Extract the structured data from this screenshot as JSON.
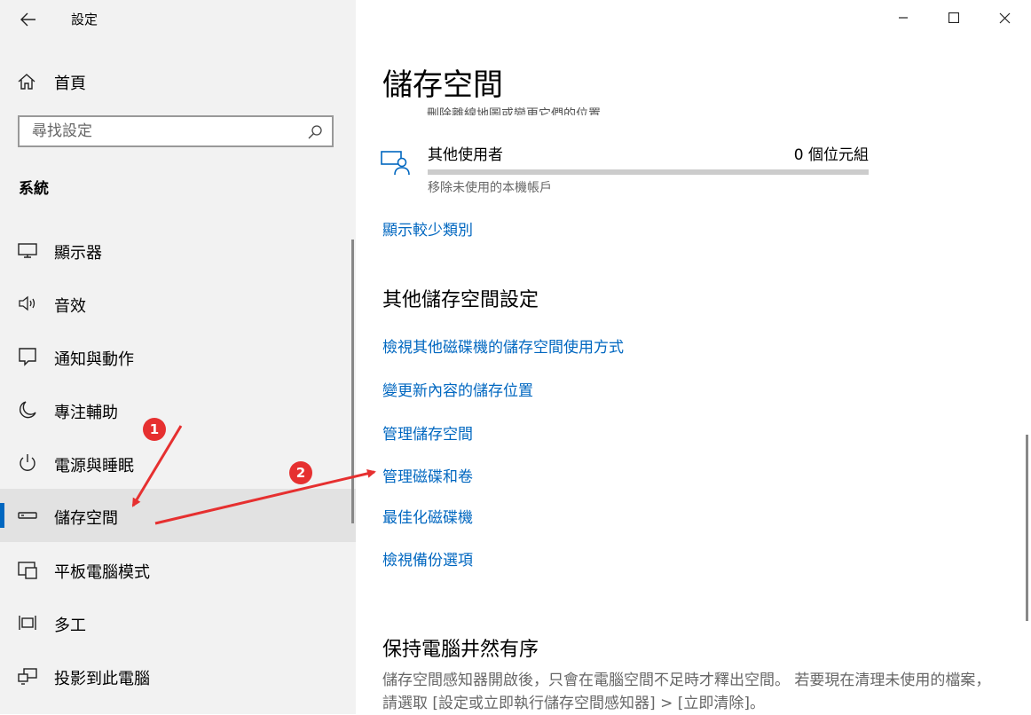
{
  "window": {
    "title": "設定",
    "back_icon": "back-arrow-icon"
  },
  "sidebar": {
    "home_label": "首頁",
    "search_placeholder": "尋找設定",
    "section_label": "系統",
    "items": [
      {
        "label": "顯示器",
        "icon": "display-icon",
        "selected": false
      },
      {
        "label": "音效",
        "icon": "speaker-icon",
        "selected": false
      },
      {
        "label": "通知與動作",
        "icon": "notification-icon",
        "selected": false
      },
      {
        "label": "專注輔助",
        "icon": "moon-icon",
        "selected": false
      },
      {
        "label": "電源與睡眠",
        "icon": "power-icon",
        "selected": false
      },
      {
        "label": "儲存空間",
        "icon": "storage-drive-icon",
        "selected": true
      },
      {
        "label": "平板電腦模式",
        "icon": "tablet-mode-icon",
        "selected": false
      },
      {
        "label": "多工",
        "icon": "multitasking-icon",
        "selected": false
      },
      {
        "label": "投影到此電腦",
        "icon": "project-icon",
        "selected": false
      }
    ]
  },
  "main": {
    "title": "儲存空間",
    "cut_off_text": "刪除離線地圖或變更它們的位置",
    "other_users": {
      "label": "其他使用者",
      "size": "0 個位元組",
      "description": "移除未使用的本機帳戶",
      "usage_fraction": 0
    },
    "show_fewer_link": "顯示較少類別",
    "more_settings_title": "其他儲存空間設定",
    "links": [
      "檢視其他磁碟機的儲存空間使用方式",
      "變更新內容的儲存位置",
      "管理儲存空間",
      "管理磁碟和卷",
      "最佳化磁碟機",
      "檢視備份選項"
    ],
    "keep_tidy_title": "保持電腦井然有序",
    "keep_tidy_desc": "儲存空間感知器開啟後，只會在電腦空間不足時才釋出空間。 若要現在清理未使用的檔案，請選取 [設定或立即執行儲存空間感知器] > [立即清除]。"
  },
  "annotations": {
    "badge1": "1",
    "badge2": "2",
    "arrow_color": "#e63030"
  },
  "colors": {
    "accent": "#0067c0",
    "sidebar_bg": "#f2f2f2",
    "selected_bg": "#e2e2e2"
  }
}
